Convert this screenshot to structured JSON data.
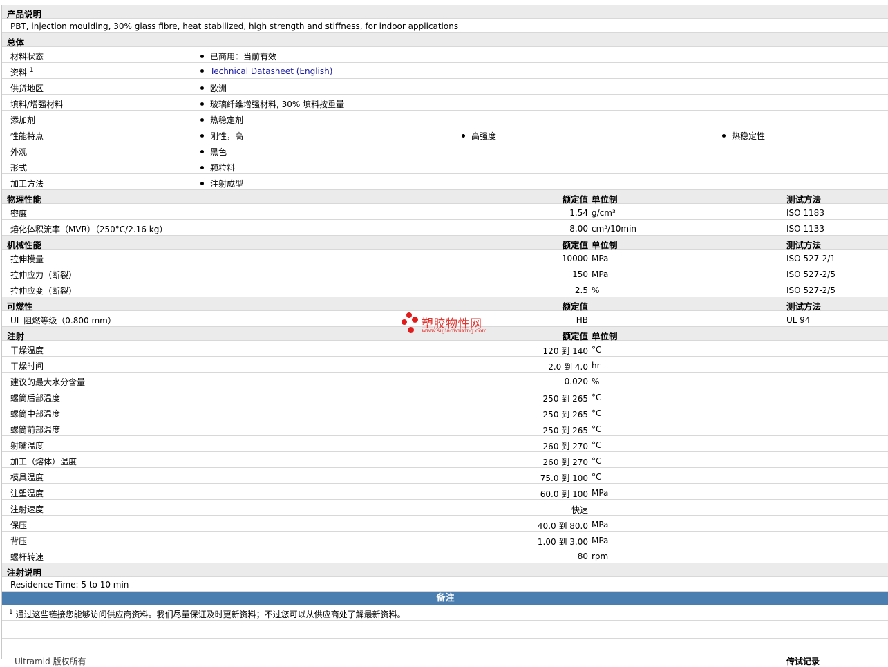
{
  "sections": {
    "description": {
      "title": "产品说明",
      "text": "PBT, injection moulding, 30% glass fibre, heat stabilized, high strength and stiffness, for indoor applications"
    },
    "general": {
      "title": "总体",
      "rows": [
        {
          "label": "材料状态",
          "values": [
            "已商用：当前有效"
          ]
        },
        {
          "label": "资料",
          "sup": "1",
          "link": "Technical Datasheet (English)"
        },
        {
          "label": "供货地区",
          "values": [
            "欧洲"
          ]
        },
        {
          "label": "填料/增强材料",
          "values": [
            "玻璃纤维增强材料, 30% 填料按重量"
          ]
        },
        {
          "label": "添加剂",
          "values": [
            "热稳定剂"
          ]
        },
        {
          "label": "性能特点",
          "values": [
            "刚性，高",
            "高强度",
            "热稳定性"
          ]
        },
        {
          "label": "外观",
          "values": [
            "黑色"
          ]
        },
        {
          "label": "形式",
          "values": [
            "颗粒料"
          ]
        },
        {
          "label": "加工方法",
          "values": [
            "注射成型"
          ]
        }
      ]
    },
    "physical": {
      "title": "物理性能",
      "h_value": "额定值",
      "h_unit": "单位制",
      "h_method": "测试方法",
      "rows": [
        {
          "label": "密度",
          "value": "1.54",
          "unit": "g/cm³",
          "method": "ISO 1183"
        },
        {
          "label": "熔化体积流率（MVR）（250°C/2.16 kg）",
          "value": "8.00",
          "unit": "cm³/10min",
          "method": "ISO 1133"
        }
      ]
    },
    "mechanical": {
      "title": "机械性能",
      "h_value": "额定值",
      "h_unit": "单位制",
      "h_method": "测试方法",
      "rows": [
        {
          "label": "拉伸模量",
          "value": "10000",
          "unit": "MPa",
          "method": "ISO 527-2/1"
        },
        {
          "label": "拉伸应力（断裂）",
          "value": "150",
          "unit": "MPa",
          "method": "ISO 527-2/5"
        },
        {
          "label": "拉伸应变（断裂）",
          "value": "2.5",
          "unit": "%",
          "method": "ISO 527-2/5"
        }
      ]
    },
    "flammability": {
      "title": "可燃性",
      "h_value": "额定值",
      "h_method": "测试方法",
      "rows": [
        {
          "label": "UL 阻燃等级（0.800 mm）",
          "value": "HB",
          "unit": "",
          "method": "UL 94"
        }
      ]
    },
    "injection": {
      "title": "注射",
      "h_value": "额定值",
      "h_unit": "单位制",
      "rows": [
        {
          "label": "干燥温度",
          "value": "120 到  140",
          "unit": "°C"
        },
        {
          "label": "干燥时间",
          "value": "2.0 到  4.0",
          "unit": "hr"
        },
        {
          "label": "建议的最大水分含量",
          "value": "0.020",
          "unit": "%"
        },
        {
          "label": "螺筒后部温度",
          "value": "250 到  265",
          "unit": "°C"
        },
        {
          "label": "螺筒中部温度",
          "value": "250 到  265",
          "unit": "°C"
        },
        {
          "label": "螺筒前部温度",
          "value": "250 到  265",
          "unit": "°C"
        },
        {
          "label": "射嘴温度",
          "value": "260 到  270",
          "unit": "°C"
        },
        {
          "label": "加工（熔体）温度",
          "value": "260 到  270",
          "unit": "°C"
        },
        {
          "label": "模具温度",
          "value": "75.0 到  100",
          "unit": "°C"
        },
        {
          "label": "注塑温度",
          "value": "60.0 到  100",
          "unit": "MPa"
        },
        {
          "label": "注射速度",
          "value": "快速",
          "unit": ""
        },
        {
          "label": "保压",
          "value": "40.0 到  80.0",
          "unit": "MPa"
        },
        {
          "label": "背压",
          "value": "1.00 到  3.00",
          "unit": "MPa"
        },
        {
          "label": "螺杆转速",
          "value": "80",
          "unit": "rpm"
        }
      ]
    },
    "injection_notes": {
      "title": "注射说明",
      "text": "Residence Time: 5 to 10 min"
    },
    "notes": {
      "title": "备注",
      "sup": "1",
      "text": "通过这些链接您能够访问供应商资料。我们尽量保证及时更新资料；不过您可以从供应商处了解最新资料。"
    },
    "cutoff": {
      "left": "Ultramid 版权所有",
      "right": "传试记录"
    }
  },
  "watermark": {
    "name": "塑胶物性网",
    "url": "www.sujiaowuxing.com"
  },
  "colors": {
    "section_bg": "#ebebeb",
    "notes_bar": "#4a7eb0",
    "link": "#1a1aa6",
    "watermark": "#e5322d"
  }
}
